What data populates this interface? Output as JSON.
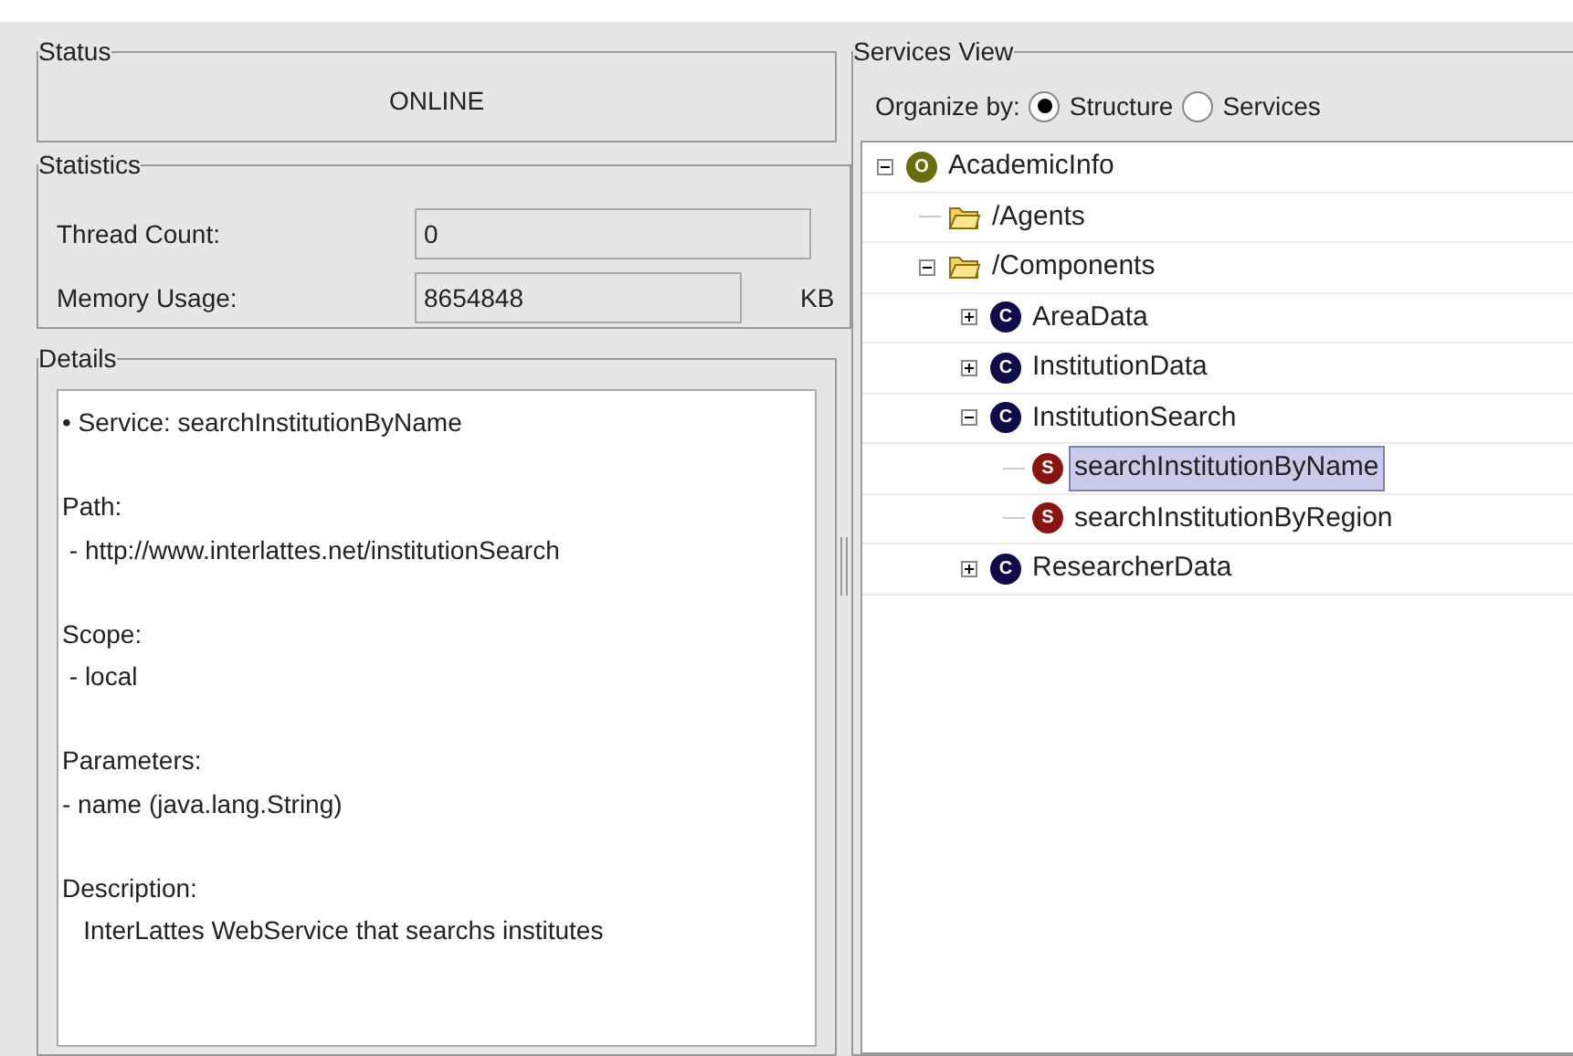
{
  "status": {
    "title": "Status",
    "value": "ONLINE"
  },
  "statistics": {
    "title": "Statistics",
    "fields": [
      {
        "label": "Thread Count:",
        "value": "0"
      },
      {
        "label": "Memory Usage:",
        "value": "8654848",
        "unit": "KB"
      }
    ]
  },
  "details": {
    "title": "Details",
    "sections": [
      {
        "heading": "• Service: searchInstitutionByName"
      },
      {
        "heading": "Path:",
        "value": " - http://www.interlattes.net/institutionSearch"
      },
      {
        "heading": "Scope:",
        "value": " - local"
      },
      {
        "heading": "Parameters:",
        "value": "- name (java.lang.String)"
      },
      {
        "heading": "Description:",
        "value": "   InterLattes WebService that searchs institutes"
      }
    ]
  },
  "services_view": {
    "title": "Services View",
    "organize_label": "Organize by:",
    "options": [
      {
        "label": "Structure",
        "selected": true
      },
      {
        "label": "Services",
        "selected": false
      }
    ],
    "tree": [
      {
        "label": "AcademicInfo",
        "kind": "organization",
        "badge": "O",
        "expanded": true,
        "selected": false,
        "children": [
          {
            "label": "/Agents",
            "kind": "folder",
            "selected": false
          },
          {
            "label": "/Components",
            "kind": "folder",
            "expanded": true,
            "selected": false,
            "children": [
              {
                "label": "AreaData",
                "kind": "component",
                "badge": "C",
                "expanded": false,
                "selected": false
              },
              {
                "label": "InstitutionData",
                "kind": "component",
                "badge": "C",
                "expanded": false,
                "selected": false
              },
              {
                "label": "InstitutionSearch",
                "kind": "component",
                "badge": "C",
                "expanded": true,
                "selected": false,
                "children": [
                  {
                    "label": "searchInstitutionByName",
                    "kind": "service",
                    "badge": "S",
                    "selected": true
                  },
                  {
                    "label": "searchInstitutionByRegion",
                    "kind": "service",
                    "badge": "S",
                    "selected": false
                  }
                ]
              },
              {
                "label": "ResearcherData",
                "kind": "component",
                "badge": "C",
                "expanded": false,
                "selected": false
              }
            ]
          }
        ]
      }
    ]
  }
}
